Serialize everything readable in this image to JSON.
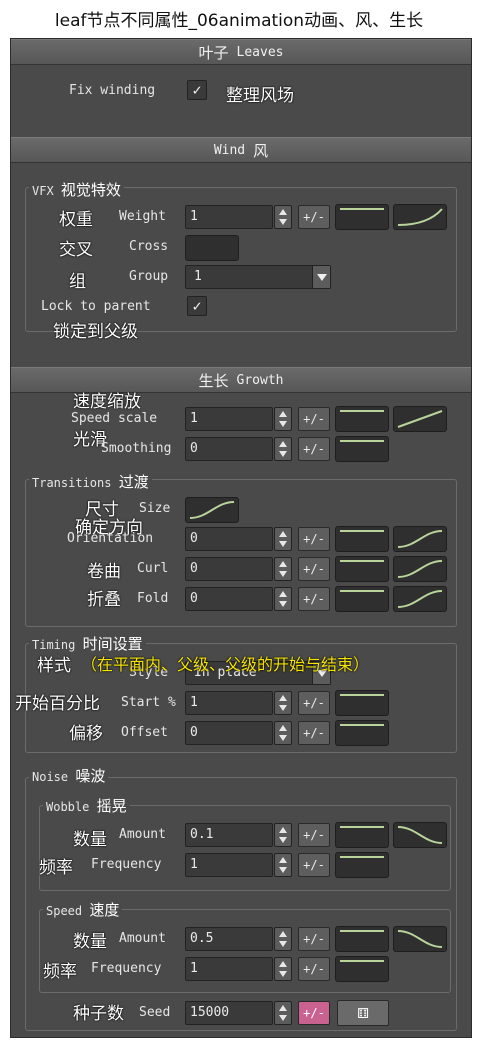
{
  "page_title": "leaf节点不同属性_06animation动画、风、生长",
  "leaves": {
    "header_cn": "叶子",
    "header_en": "Leaves",
    "fix_winding_label": "Fix winding",
    "fix_winding_checked": true,
    "fix_winding_cn": "整理风场"
  },
  "wind": {
    "header_en": "Wind",
    "header_cn": "风",
    "vfx": {
      "title_en": "VFX",
      "title_cn": "视觉特效",
      "weight": {
        "cn": "权重",
        "label": "Weight",
        "value": "1",
        "pm": "+/-"
      },
      "cross": {
        "cn": "交叉",
        "label": "Cross"
      },
      "group": {
        "cn": "组",
        "label": "Group",
        "value": "1"
      },
      "lock": {
        "label": "Lock to parent",
        "checked": true,
        "cn": "锁定到父级"
      }
    }
  },
  "growth": {
    "header_cn": "生长",
    "header_en": "Growth",
    "speed_scale": {
      "cn": "速度缩放",
      "label": "Speed scale",
      "value": "1",
      "pm": "+/-"
    },
    "smoothing": {
      "cn": "光滑",
      "label": "Smoothing",
      "value": "0",
      "pm": "+/-"
    },
    "transitions": {
      "title_en": "Transitions",
      "title_cn": "过渡",
      "size": {
        "cn": "尺寸",
        "label": "Size"
      },
      "orientation": {
        "cn": "确定方向",
        "label": "Orientation",
        "value": "0",
        "pm": "+/-"
      },
      "curl": {
        "cn": "卷曲",
        "label": "Curl",
        "value": "0",
        "pm": "+/-"
      },
      "fold": {
        "cn": "折叠",
        "label": "Fold",
        "value": "0",
        "pm": "+/-"
      }
    },
    "timing": {
      "title_en": "Timing",
      "title_cn": "时间设置",
      "style": {
        "cn": "样式",
        "label": "Style",
        "value": "In place",
        "note_cn": "（在平面内、父级、父级的开始与结束）"
      },
      "start": {
        "cn": "开始百分比",
        "label": "Start %",
        "value": "1",
        "pm": "+/-"
      },
      "offset": {
        "cn": "偏移",
        "label": "Offset",
        "value": "0",
        "pm": "+/-"
      }
    },
    "noise": {
      "title_en": "Noise",
      "title_cn": "噪波",
      "wobble": {
        "title_en": "Wobble",
        "title_cn": "摇晃",
        "amount": {
          "cn": "数量",
          "label": "Amount",
          "value": "0.1",
          "pm": "+/-"
        },
        "frequency": {
          "cn": "频率",
          "label": "Frequency",
          "value": "1",
          "pm": "+/-"
        }
      },
      "speed": {
        "title_en": "Speed",
        "title_cn": "速度",
        "amount": {
          "cn": "数量",
          "label": "Amount",
          "value": "0.5",
          "pm": "+/-"
        },
        "frequency": {
          "cn": "频率",
          "label": "Frequency",
          "value": "1",
          "pm": "+/-"
        }
      },
      "seed": {
        "cn": "种子数",
        "label": "Seed",
        "value": "15000",
        "pm": "+/-"
      }
    }
  },
  "icons": {
    "check": "✓",
    "dice": "⚅"
  },
  "colors": {
    "curve_line": "#b8d49a",
    "randomize_active": "#c9628f"
  }
}
